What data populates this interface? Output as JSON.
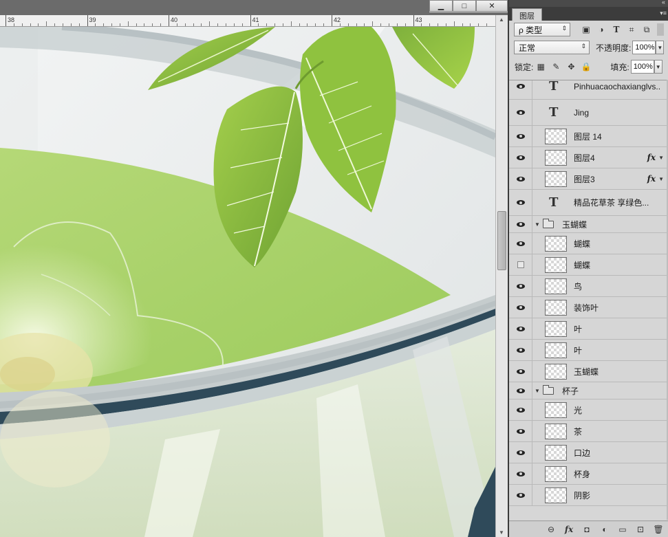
{
  "window": {
    "minimize_glyph": "▁",
    "maximize_glyph": "□",
    "close_glyph": "✕"
  },
  "ruler": {
    "labels": [
      "38",
      "39",
      "40",
      "41",
      "42",
      "43"
    ]
  },
  "panel": {
    "tab_label": "图层",
    "collapse_glyph": "«",
    "menu_glyph": "▾≡",
    "filter_type_label": "ρ 类型",
    "blend_mode": "正常",
    "opacity_label": "不透明度:",
    "opacity_value": "100%",
    "lock_label": "锁定:",
    "fill_label": "填充:",
    "fill_value": "100%"
  },
  "layers": [
    {
      "kind": "text",
      "name": "Pinhuacaochaxianglvs...",
      "visible": true,
      "fx": false
    },
    {
      "kind": "text",
      "name": "Jing",
      "visible": true,
      "fx": false
    },
    {
      "kind": "pixel",
      "name": "图层 14",
      "visible": true,
      "fx": false
    },
    {
      "kind": "pixel",
      "name": "图层4",
      "visible": true,
      "fx": true
    },
    {
      "kind": "pixel",
      "name": "图层3",
      "visible": true,
      "fx": true
    },
    {
      "kind": "text",
      "name": "精品花草茶 享绿色...",
      "visible": true,
      "fx": false
    },
    {
      "kind": "group",
      "name": "玉蝴蝶",
      "visible": true,
      "fx": false
    },
    {
      "kind": "pixel",
      "name": "蝴蝶",
      "visible": true,
      "fx": false
    },
    {
      "kind": "pixel",
      "name": "蝴蝶",
      "visible": false,
      "fx": false
    },
    {
      "kind": "pixel",
      "name": "鸟",
      "visible": true,
      "fx": false
    },
    {
      "kind": "pixel",
      "name": "装饰叶",
      "visible": true,
      "fx": false
    },
    {
      "kind": "pixel",
      "name": "叶",
      "visible": true,
      "fx": false
    },
    {
      "kind": "pixel",
      "name": "叶",
      "visible": true,
      "fx": false
    },
    {
      "kind": "pixel",
      "name": "玉蝴蝶",
      "visible": true,
      "fx": false
    },
    {
      "kind": "group",
      "name": "杯子",
      "visible": true,
      "fx": false
    },
    {
      "kind": "pixel",
      "name": "光",
      "visible": true,
      "fx": false
    },
    {
      "kind": "pixel",
      "name": "茶",
      "visible": true,
      "fx": false
    },
    {
      "kind": "pixel",
      "name": "口边",
      "visible": true,
      "fx": false
    },
    {
      "kind": "pixel",
      "name": "杯身",
      "visible": true,
      "fx": false
    },
    {
      "kind": "pixel",
      "name": "阴影",
      "visible": true,
      "fx": false
    }
  ],
  "fx_label": "fx",
  "text_layer_glyph": "T",
  "footer_icons": [
    "link-icon",
    "fx-icon",
    "mask-icon",
    "adjustment-icon",
    "group-icon",
    "new-layer-icon",
    "trash-icon"
  ],
  "footer_glyphs": [
    "⊖",
    "fx",
    "◘",
    "◐",
    "▭",
    "⊡",
    "🗑"
  ],
  "colors": {
    "leaf_green": "#8fc23f",
    "tea_green": "#a9d16a",
    "cup_rim_dark": "#2f4a5a",
    "cup_gray": "#c4cbcc"
  }
}
